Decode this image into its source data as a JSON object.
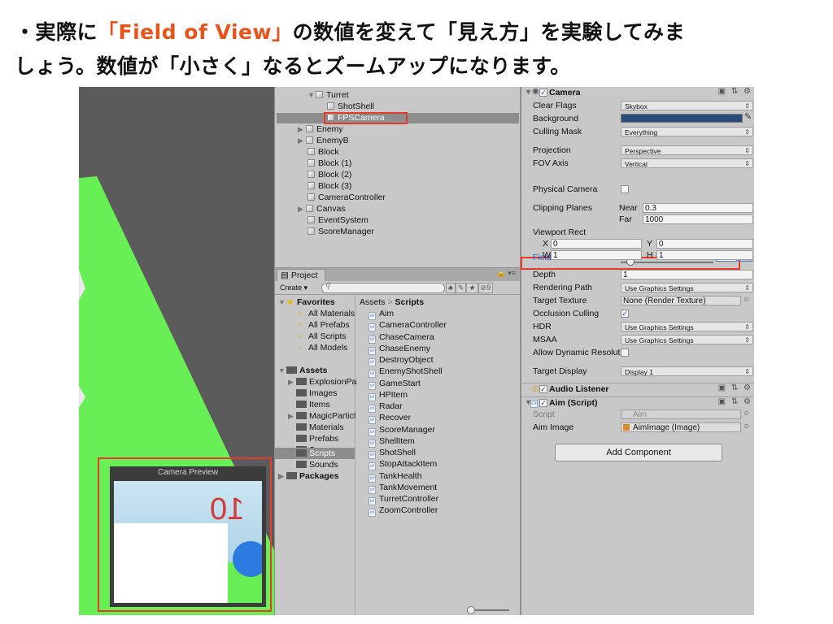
{
  "header": {
    "line1_pre": "・実際に",
    "line1_accent": "「Field of View」",
    "line1_post": "の数値を変えて「見え方」を実験してみま",
    "line2": "しょう。数値が「小さく」なるとズームアップになります。"
  },
  "colors": {
    "accent": "#e8531c",
    "highlight_box": "#e53b2b",
    "scene_green": "#68ef55"
  },
  "scene": {
    "preview_title": "Camera Preview",
    "preview_number": "10"
  },
  "hierarchy": {
    "items": [
      {
        "label": "Turret",
        "icon": "cube-icon",
        "expanded": true
      },
      {
        "label": "ShotShell",
        "icon": "cube-icon"
      },
      {
        "label": "FPSCamera",
        "icon": "cube-icon",
        "selected": true
      },
      {
        "label": "Enemy",
        "icon": "cube-icon",
        "collapsed": true
      },
      {
        "label": "EnemyB",
        "icon": "cube-icon",
        "collapsed": true
      },
      {
        "label": "Block",
        "icon": "cube-icon"
      },
      {
        "label": "Block (1)",
        "icon": "cube-icon"
      },
      {
        "label": "Block (2)",
        "icon": "cube-icon"
      },
      {
        "label": "Block (3)",
        "icon": "cube-icon"
      },
      {
        "label": "CameraController",
        "icon": "cube-icon"
      },
      {
        "label": "Canvas",
        "icon": "cube-icon",
        "collapsed": true
      },
      {
        "label": "EventSystem",
        "icon": "cube-icon"
      },
      {
        "label": "ScoreManager",
        "icon": "cube-icon"
      }
    ]
  },
  "project": {
    "tab_label": "Project",
    "create_label": "Create ▾",
    "search_placeholder": "",
    "hidden_count": "9",
    "favorites_label": "Favorites",
    "favorites": [
      "All Materials",
      "All Prefabs",
      "All Scripts",
      "All Models"
    ],
    "assets_label": "Assets",
    "asset_folders": [
      "ExplosionPa",
      "Images",
      "Items",
      "MagicParticl",
      "Materials",
      "Prefabs",
      "Scenes",
      "Scripts",
      "Sounds"
    ],
    "packages_label": "Packages",
    "breadcrumb_root": "Assets",
    "breadcrumb_sep": ">",
    "breadcrumb_current": "Scripts",
    "scripts": [
      "Aim",
      "CameraController",
      "ChaseCamera",
      "ChaseEnemy",
      "DestroyObject",
      "EnemyShotShell",
      "GameStart",
      "HPItem",
      "Radar",
      "Recover",
      "ScoreManager",
      "ShellItem",
      "ShotShell",
      "StopAttackItem",
      "TankHealth",
      "TankMovement",
      "TurretController",
      "ZoomController"
    ]
  },
  "inspector": {
    "camera_title": "Camera",
    "clear_flags_label": "Clear Flags",
    "clear_flags_value": "Skybox",
    "background_label": "Background",
    "background_color": "#2a4a77",
    "culling_mask_label": "Culling Mask",
    "culling_mask_value": "Everything",
    "projection_label": "Projection",
    "projection_value": "Perspective",
    "fov_axis_label": "FOV Axis",
    "fov_axis_value": "Vertical",
    "fov_label": "Field of View",
    "fov_value": "20",
    "physical_camera_label": "Physical Camera",
    "clipping_label": "Clipping Planes",
    "near_label": "Near",
    "near_value": "0.3",
    "far_label": "Far",
    "far_value": "1000",
    "viewport_label": "Viewport Rect",
    "vp_x_label": "X",
    "vp_x": "0",
    "vp_y_label": "Y",
    "vp_y": "0",
    "vp_w_label": "W",
    "vp_w": "1",
    "vp_h_label": "H",
    "vp_h": "1",
    "depth_label": "Depth",
    "depth_value": "1",
    "rendering_path_label": "Rendering Path",
    "rendering_path_value": "Use Graphics Settings",
    "target_texture_label": "Target Texture",
    "target_texture_value": "None (Render Texture)",
    "occlusion_label": "Occlusion Culling",
    "occlusion_checked": true,
    "hdr_label": "HDR",
    "hdr_value": "Use Graphics Settings",
    "msaa_label": "MSAA",
    "msaa_value": "Use Graphics Settings",
    "dynamic_res_label": "Allow Dynamic Resolut",
    "target_display_label": "Target Display",
    "target_display_value": "Display 1",
    "audio_title": "Audio Listener",
    "aim_title": "Aim (Script)",
    "script_label": "Script",
    "script_value": "Aim",
    "aim_image_label": "Aim Image",
    "aim_image_value": "AimImage (Image)",
    "add_component_label": "Add Component"
  }
}
